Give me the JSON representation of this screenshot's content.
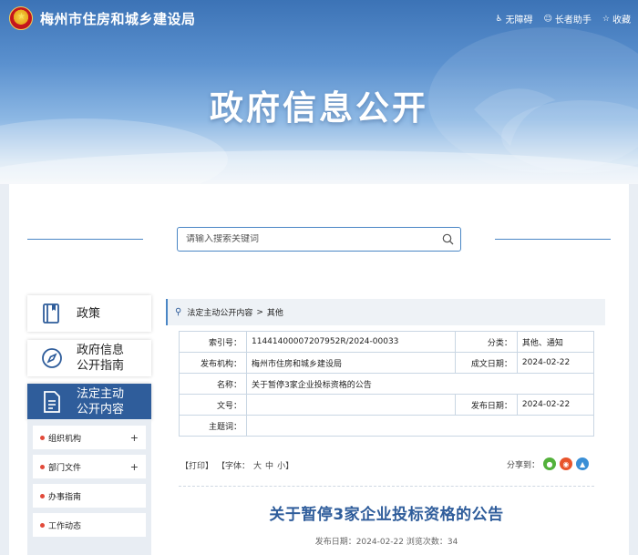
{
  "header": {
    "site_name": "梅州市住房和城乡建设局",
    "links": [
      {
        "label": "无障碍",
        "icon": "accessibility-icon"
      },
      {
        "label": "长者助手",
        "icon": "elder-helper-icon"
      },
      {
        "label": "收藏",
        "icon": "favorite-icon"
      }
    ],
    "banner_title": "政府信息公开",
    "emblem_icon": "national-emblem-icon"
  },
  "search": {
    "placeholder": "请输入搜索关键词",
    "icon": "search-icon"
  },
  "sidebar": {
    "items": [
      {
        "label": "政策",
        "icon": "book-icon"
      },
      {
        "label_lines": [
          "政府信息",
          "公开指南"
        ],
        "icon": "compass-icon"
      },
      {
        "label_lines": [
          "法定主动",
          "公开内容"
        ],
        "icon": "document-icon",
        "active": true
      }
    ],
    "sub_items": [
      {
        "label": "组织机构",
        "expand": "+"
      },
      {
        "label": "部门文件",
        "expand": "+"
      },
      {
        "label": "办事指南",
        "expand": ""
      },
      {
        "label": "工作动态",
        "expand": ""
      }
    ]
  },
  "breadcrumb": {
    "icon": "location-pin-icon",
    "items": [
      "法定主动公开内容",
      "其他"
    ],
    "separator": ">"
  },
  "meta_table": {
    "index_label": "索引号：",
    "index_value": "11441400007207952R/2024-00033",
    "category_label": "分类：",
    "category_value": "其他、通知",
    "publisher_label": "发布机构：",
    "publisher_value": "梅州市住房和城乡建设局",
    "created_label": "成文日期：",
    "created_value": "2024-02-22",
    "name_label": "名称：",
    "name_value": "关于暂停3家企业投标资格的公告",
    "docno_label": "文号：",
    "docno_value": "",
    "pubdate_label": "发布日期：",
    "pubdate_value": "2024-02-22",
    "subject_label": "主题词：",
    "subject_value": ""
  },
  "tools": {
    "print": "【打印】",
    "font_label": "【字体：",
    "font_large": "大",
    "font_medium": "中",
    "font_small": "小】"
  },
  "share": {
    "label": "分享到：",
    "targets": [
      {
        "name": "wechat-icon",
        "color": "#53b13b"
      },
      {
        "name": "weibo-icon",
        "color": "#e8542b"
      },
      {
        "name": "qq-icon",
        "color": "#3a8fd6"
      }
    ]
  },
  "article": {
    "title": "关于暂停3家企业投标资格的公告",
    "meta_line": "发布日期：2024-02-22    浏览次数：34"
  }
}
